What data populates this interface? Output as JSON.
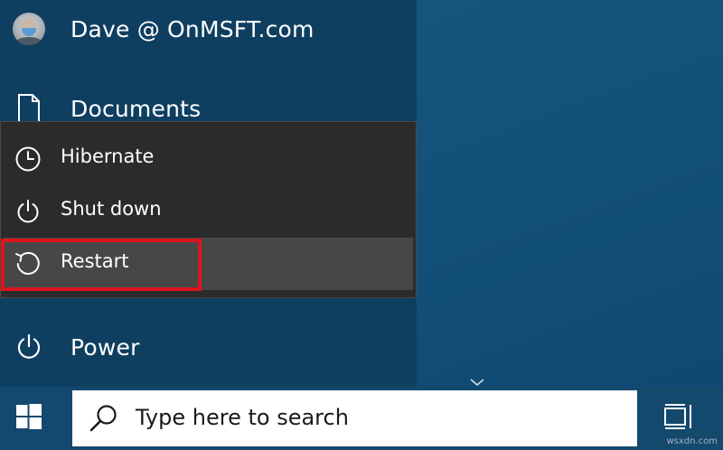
{
  "start_menu": {
    "user": {
      "name": "Dave @ OnMSFT.com",
      "icon": "avatar"
    },
    "documents": {
      "label": "Documents",
      "icon": "document-icon"
    },
    "power": {
      "label": "Power",
      "icon": "power-icon"
    }
  },
  "power_popup": {
    "items": [
      {
        "label": "Hibernate",
        "icon": "clock-icon"
      },
      {
        "label": "Shut down",
        "icon": "power-icon"
      },
      {
        "label": "Restart",
        "icon": "restart-icon",
        "highlighted": true
      }
    ]
  },
  "taskbar": {
    "start_icon": "windows-logo-icon",
    "search": {
      "placeholder": "Type here to search",
      "icon": "search-icon"
    },
    "task_view_icon": "task-view-icon"
  },
  "watermark": "wsxdn.com",
  "colors": {
    "desktop": "#12507a",
    "menu": "#0f3f60",
    "popup": "#2b2b2b",
    "selected": "#474747",
    "highlight": "#e0131d",
    "taskbar": "#14496e"
  }
}
